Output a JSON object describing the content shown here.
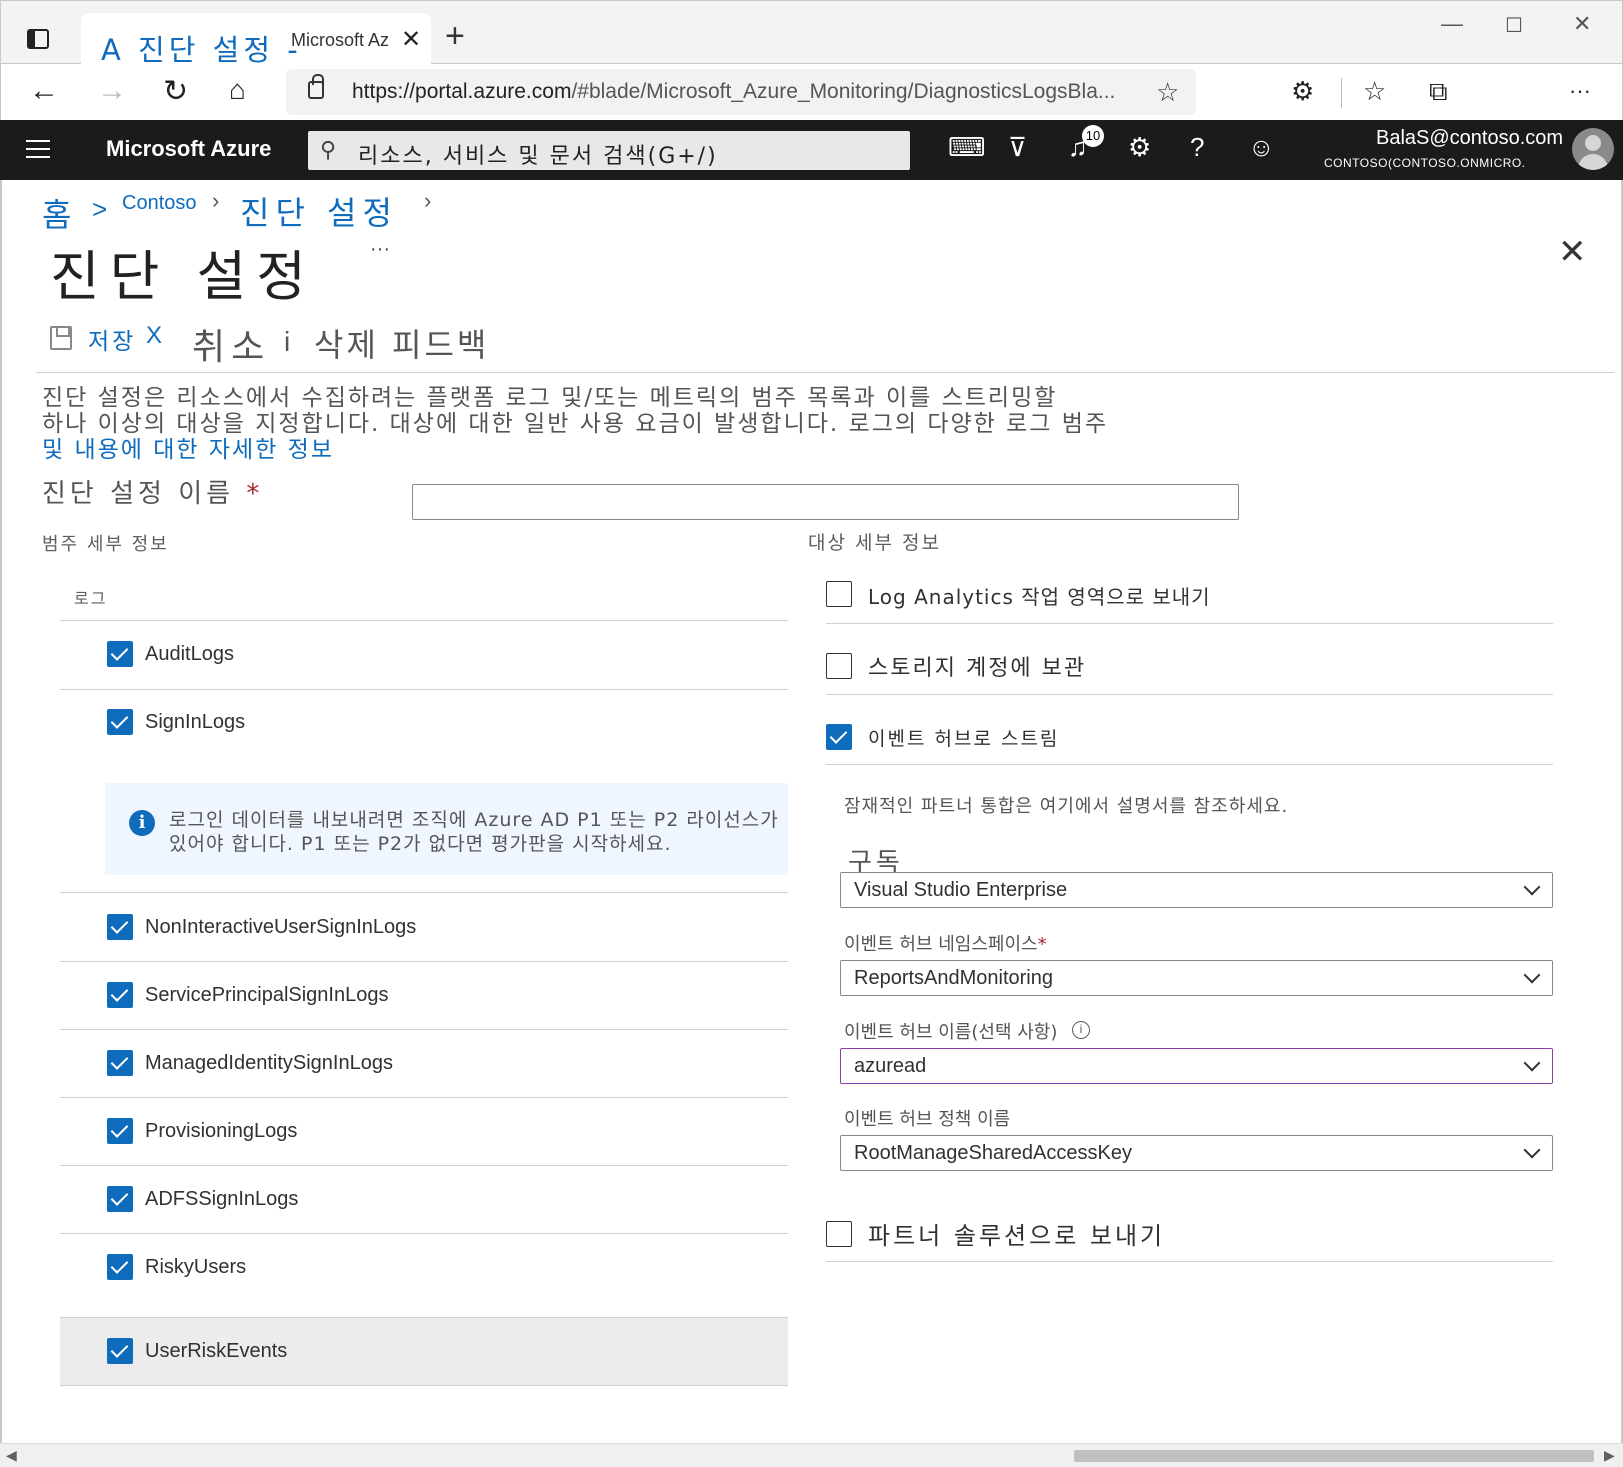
{
  "browser": {
    "tab_title_prefix": "A 진단 설정 -",
    "tab_title_suffix": "Microsoft Az",
    "new_tab": "+",
    "url_host": "https://portal.azure.com",
    "url_path": "/#blade/Microsoft_Azure_Monitoring/DiagnosticsLogsBla..."
  },
  "azure": {
    "brand": "Microsoft Azure",
    "search_placeholder": "리소스, 서비스 및 문서 검색(G+/)",
    "notification_count": "10",
    "user_email": "BalaS@contoso.com",
    "user_directory": "CONTOSO(CONTOSO.ONMICRO."
  },
  "breadcrumb": {
    "home": "홈",
    "sep1": ">",
    "tenant": "Contoso",
    "current": "진단 설정"
  },
  "page": {
    "title": "진단 설정",
    "more": "···"
  },
  "commands": {
    "save": "저장",
    "cancel_x": "X",
    "cancel": "취소",
    "i": "i",
    "delete_feedback": "삭제 피드백"
  },
  "description": {
    "line1": "진단 설정은 리소스에서 수집하려는 플랫폼 로그 및/또는 메트릭의 범주 목록과 이를 스트리밍할",
    "line2": "하나 이상의 대상을 지정합니다. 대상에 대한 일반 사용 요금이 발생합니다. 로그의 다양한 로그 범주",
    "link": "및 내용에 대한 자세한 정보"
  },
  "name_field": {
    "label": "진단 설정 이름",
    "required": "*",
    "value": ""
  },
  "categories": {
    "header": "범주 세부 정보",
    "logs_header": "로그",
    "logs": [
      {
        "label": "AuditLogs",
        "checked": true
      },
      {
        "label": "SignInLogs",
        "checked": true
      },
      {
        "label": "NonInteractiveUserSignInLogs",
        "checked": true
      },
      {
        "label": "ServicePrincipalSignInLogs",
        "checked": true
      },
      {
        "label": "ManagedIdentitySignInLogs",
        "checked": true
      },
      {
        "label": "ProvisioningLogs",
        "checked": true
      },
      {
        "label": "ADFSSignInLogs",
        "checked": true
      },
      {
        "label": "RiskyUsers",
        "checked": true
      },
      {
        "label": "UserRiskEvents",
        "checked": true
      }
    ],
    "signin_info": {
      "line1": "로그인 데이터를 내보내려면 조직에 Azure AD P1 또는 P2 라이선스가",
      "line2": "있어야 합니다. P1 또는 P2가 없다면 평가판을 시작하세요."
    }
  },
  "destinations": {
    "header": "대상 세부 정보",
    "log_analytics": {
      "label": "Log Analytics 작업 영역으로 보내기",
      "checked": false
    },
    "storage": {
      "label": "스토리지 계정에 보관",
      "checked": false
    },
    "event_hub": {
      "label": "이벤트 허브로 스트림",
      "checked": true
    },
    "partner_note": "잠재적인 파트너 통합은 여기에서 설명서를 참조하세요.",
    "subscription": {
      "label": "구독",
      "value": "Visual Studio Enterprise"
    },
    "namespace": {
      "label": "이벤트 허브 네임스페이스",
      "required": "*",
      "value": "ReportsAndMonitoring"
    },
    "hub_name": {
      "label": "이벤트 허브 이름(선택 사항)",
      "info": "i",
      "value": "azuread"
    },
    "policy": {
      "label": "이벤트 허브 정책 이름",
      "value": "RootManageSharedAccessKey"
    },
    "partner": {
      "label": "파트너 솔루션으로 보내기",
      "checked": false
    }
  },
  "colors": {
    "accent": "#0f6cbd",
    "header_bg": "#1b1b1b",
    "required": "#a4262c",
    "focus_border": "#8a3ea8"
  }
}
